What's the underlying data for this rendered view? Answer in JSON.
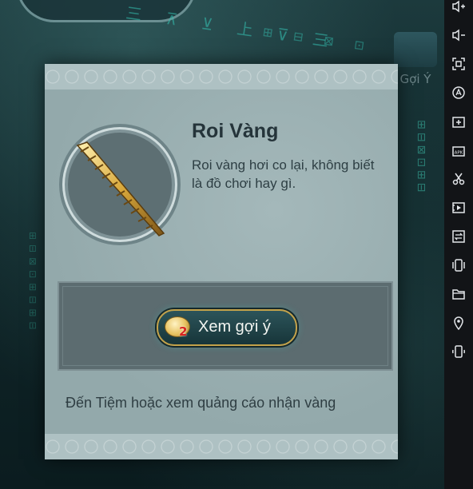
{
  "item": {
    "name": "Roi Vàng",
    "description": "Roi vàng hơi co lại, không biết là đồ chơi hay gì."
  },
  "actions": {
    "watch_hint_label": "Xem gợi ý",
    "hint_cost": "2"
  },
  "footer": {
    "note": "Đến Tiệm hoặc xem quảng cáo nhận vàng"
  },
  "background": {
    "hint_button_label": "Gợi Ý"
  },
  "toolbar": {
    "icons": [
      "volume-up-icon",
      "volume-down-icon",
      "screenshot-icon",
      "keymap-icon",
      "add-window-icon",
      "install-apk-icon",
      "scissors-icon",
      "video-icon",
      "sync-settings-icon",
      "shake-icon",
      "folder-icon",
      "location-icon",
      "rotate-icon"
    ]
  },
  "colors": {
    "panel": "#9bb1b3",
    "button_border": "#c3a24a",
    "cost_red": "#d8231f"
  }
}
